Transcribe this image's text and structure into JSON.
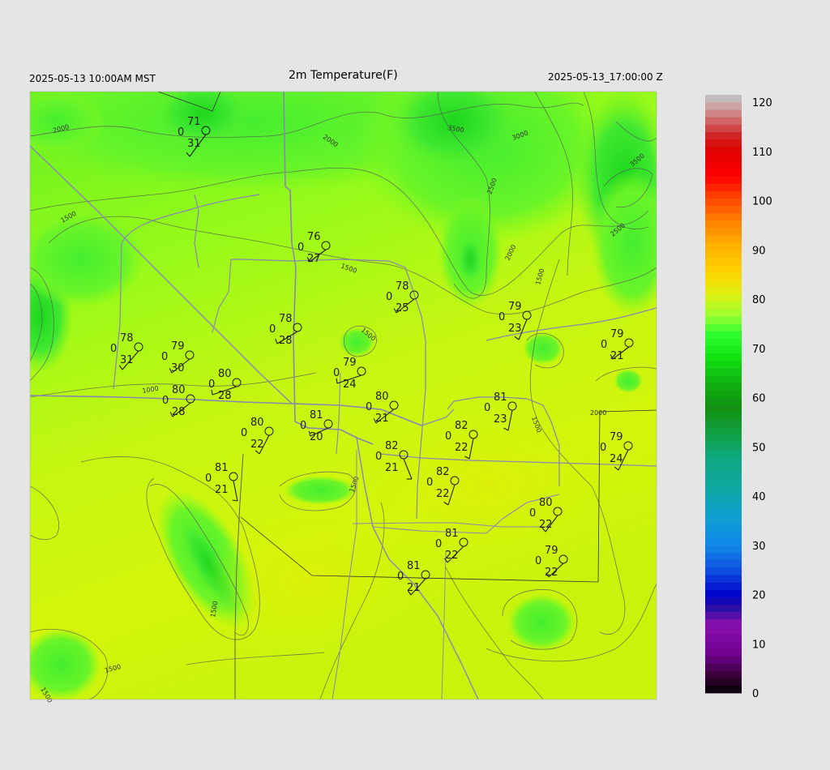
{
  "header": {
    "local_time": "2025-05-13 10:00AM MST",
    "title": "2m Temperature(F)",
    "utc_time": "2025-05-13_17:00:00 Z"
  },
  "colorbar": {
    "ticks": [
      "120",
      "110",
      "100",
      "90",
      "80",
      "70",
      "60",
      "50",
      "40",
      "30",
      "20",
      "10",
      "0"
    ],
    "stops": [
      {
        "v": 0,
        "c": "#000000"
      },
      {
        "v": 3,
        "c": "#300030"
      },
      {
        "v": 8,
        "c": "#700090"
      },
      {
        "v": 14,
        "c": "#8a10b0"
      },
      {
        "v": 17,
        "c": "#3010a0"
      },
      {
        "v": 20,
        "c": "#0000c8"
      },
      {
        "v": 25,
        "c": "#1050e0"
      },
      {
        "v": 30,
        "c": "#1088e8"
      },
      {
        "v": 36,
        "c": "#10a0d0"
      },
      {
        "v": 42,
        "c": "#10a8a0"
      },
      {
        "v": 48,
        "c": "#10a880"
      },
      {
        "v": 53,
        "c": "#10a040"
      },
      {
        "v": 58,
        "c": "#109010"
      },
      {
        "v": 63,
        "c": "#10b010"
      },
      {
        "v": 68,
        "c": "#10e010"
      },
      {
        "v": 73,
        "c": "#30ff30"
      },
      {
        "v": 77,
        "c": "#a0ff30"
      },
      {
        "v": 81,
        "c": "#e0f010"
      },
      {
        "v": 86,
        "c": "#ffd000"
      },
      {
        "v": 91,
        "c": "#ffb000"
      },
      {
        "v": 96,
        "c": "#ff8000"
      },
      {
        "v": 101,
        "c": "#ff4000"
      },
      {
        "v": 105,
        "c": "#ff0000"
      },
      {
        "v": 110,
        "c": "#e00000"
      },
      {
        "v": 113,
        "c": "#d02020"
      },
      {
        "v": 116,
        "c": "#d06060"
      },
      {
        "v": 119,
        "c": "#d0a0a0"
      },
      {
        "v": 121,
        "c": "#c0c0c0"
      }
    ]
  },
  "contour_labels": [
    "2000",
    "2000",
    "3500",
    "3000",
    "3500",
    "2500",
    "2500",
    "2000",
    "1500",
    "1500",
    "1500",
    "1500",
    "1000",
    "1500",
    "2000",
    "1500",
    "1500",
    "1500",
    "1500"
  ],
  "stations": [
    {
      "t": "71",
      "w": "0",
      "d": "31"
    },
    {
      "t": "76",
      "w": "0",
      "d": "27"
    },
    {
      "t": "78",
      "w": "0",
      "d": "25"
    },
    {
      "t": "79",
      "w": "0",
      "d": "23"
    },
    {
      "t": "78",
      "w": "0",
      "d": "28"
    },
    {
      "t": "78",
      "w": "0",
      "d": "31"
    },
    {
      "t": "79",
      "w": "0",
      "d": "30"
    },
    {
      "t": "79",
      "w": "0",
      "d": "24"
    },
    {
      "t": "79",
      "w": "0",
      "d": "21"
    },
    {
      "t": "80",
      "w": "0",
      "d": "28"
    },
    {
      "t": "80",
      "w": "0",
      "d": "28"
    },
    {
      "t": "80",
      "w": "0",
      "d": "21"
    },
    {
      "t": "81",
      "w": "0",
      "d": "20"
    },
    {
      "t": "81",
      "w": "0",
      "d": "23"
    },
    {
      "t": "80",
      "w": "0",
      "d": "22"
    },
    {
      "t": "82",
      "w": "0",
      "d": "22"
    },
    {
      "t": "79",
      "w": "0",
      "d": "24"
    },
    {
      "t": "81",
      "w": "0",
      "d": "21"
    },
    {
      "t": "82",
      "w": "0",
      "d": "21"
    },
    {
      "t": "82",
      "w": "0",
      "d": "22"
    },
    {
      "t": "80",
      "w": "0",
      "d": "22"
    },
    {
      "t": "81",
      "w": "0",
      "d": "22"
    },
    {
      "t": "79",
      "w": "0",
      "d": "22"
    },
    {
      "t": "81",
      "w": "0",
      "d": "21"
    }
  ]
}
